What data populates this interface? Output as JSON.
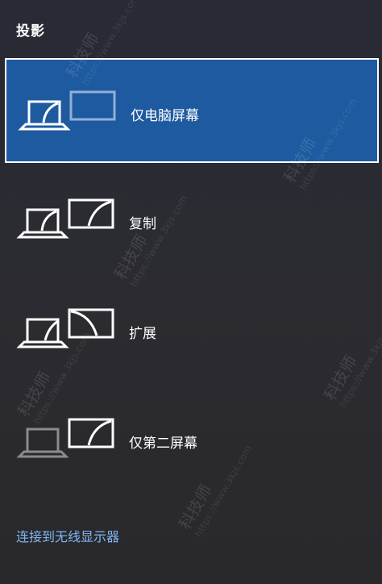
{
  "panel": {
    "title": "投影"
  },
  "options": [
    {
      "label": "仅电脑屏幕",
      "selected": true
    },
    {
      "label": "复制",
      "selected": false
    },
    {
      "label": "扩展",
      "selected": false
    },
    {
      "label": "仅第二屏幕",
      "selected": false
    }
  ],
  "footer": {
    "wireless_link": "连接到无线显示器"
  },
  "watermark": {
    "brand": "科技师",
    "url": "https://www.3kjs.com"
  },
  "colors": {
    "selected_bg": "#1e5aa0",
    "link": "#7fb6f2",
    "panel_bg": "#2b2b31"
  },
  "icons": [
    "laptop-icon",
    "monitor-icon"
  ]
}
